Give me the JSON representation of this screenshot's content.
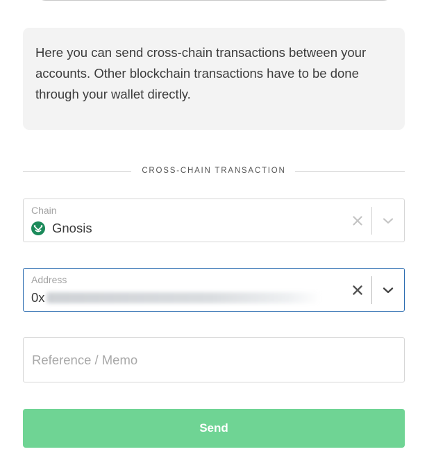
{
  "info": {
    "text": "Here you can send cross-chain transactions between your accounts. Other blockchain transactions have to be done through your wallet directly."
  },
  "section": {
    "title": "CROSS-CHAIN TRANSACTION"
  },
  "chain_field": {
    "label": "Chain",
    "value": "Gnosis",
    "icon": "gnosis-logo-icon"
  },
  "address_field": {
    "label": "Address",
    "prefix": "0x",
    "redacted": true
  },
  "memo_field": {
    "placeholder": "Reference / Memo",
    "value": ""
  },
  "send_button": {
    "label": "Send"
  },
  "colors": {
    "accent_green": "#6fd494",
    "focus_blue": "#2b6cb0",
    "info_bg": "#f3f3f3",
    "gnosis_green": "#1b8a5a"
  }
}
